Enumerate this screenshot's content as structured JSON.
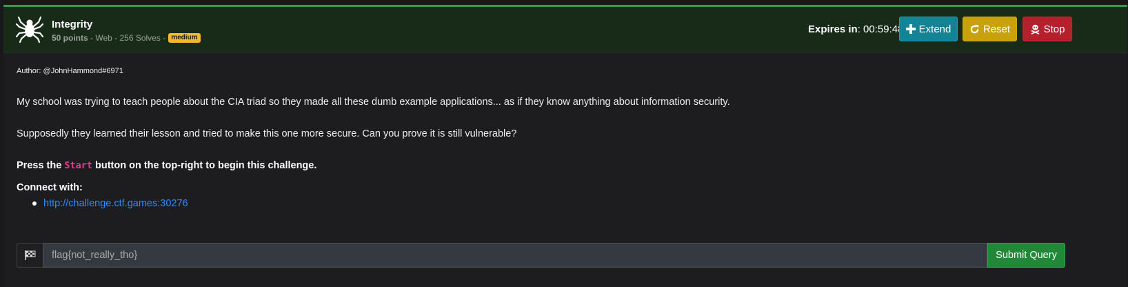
{
  "challenge": {
    "title": "Integrity",
    "points": "50 points",
    "meta_rest": "- Web - 256 Solves -",
    "difficulty": "medium"
  },
  "timer": {
    "label": "Expires in",
    "value": ": 00:59:48"
  },
  "actions": {
    "extend_label": "Extend",
    "reset_label": "Reset",
    "stop_label": "Stop"
  },
  "body": {
    "author": "Author: @JohnHammond#6971",
    "para1": "My school was trying to teach people about the CIA triad so they made all these dumb example applications... as if they know anything about information security.",
    "para2": "Supposedly they learned their lesson and tried to make this one more secure. Can you prove it is still vulnerable?",
    "start_prefix": "Press the",
    "start_code": "Start",
    "start_suffix": "button on the top-right to begin this challenge.",
    "connect_label": "Connect with:",
    "links": [
      "http://challenge.ctf.games:30276"
    ]
  },
  "flag_form": {
    "placeholder": "flag{not_really_tho}",
    "value": "",
    "submit_label": "Submit Query"
  },
  "colors": {
    "header_bg": "#172b18",
    "header_accent": "#2ea043",
    "extend": "#138496",
    "reset": "#c9a10a",
    "stop": "#b5202d",
    "submit": "#218838",
    "badge": "#f5b82e",
    "link": "#2f8cff",
    "code": "#e83e8c"
  },
  "icons": {
    "logo": "spider-icon",
    "extend": "plus-icon",
    "reset": "redo-icon",
    "stop": "skull-crossbones-icon",
    "flag": "checkered-flag-icon"
  }
}
